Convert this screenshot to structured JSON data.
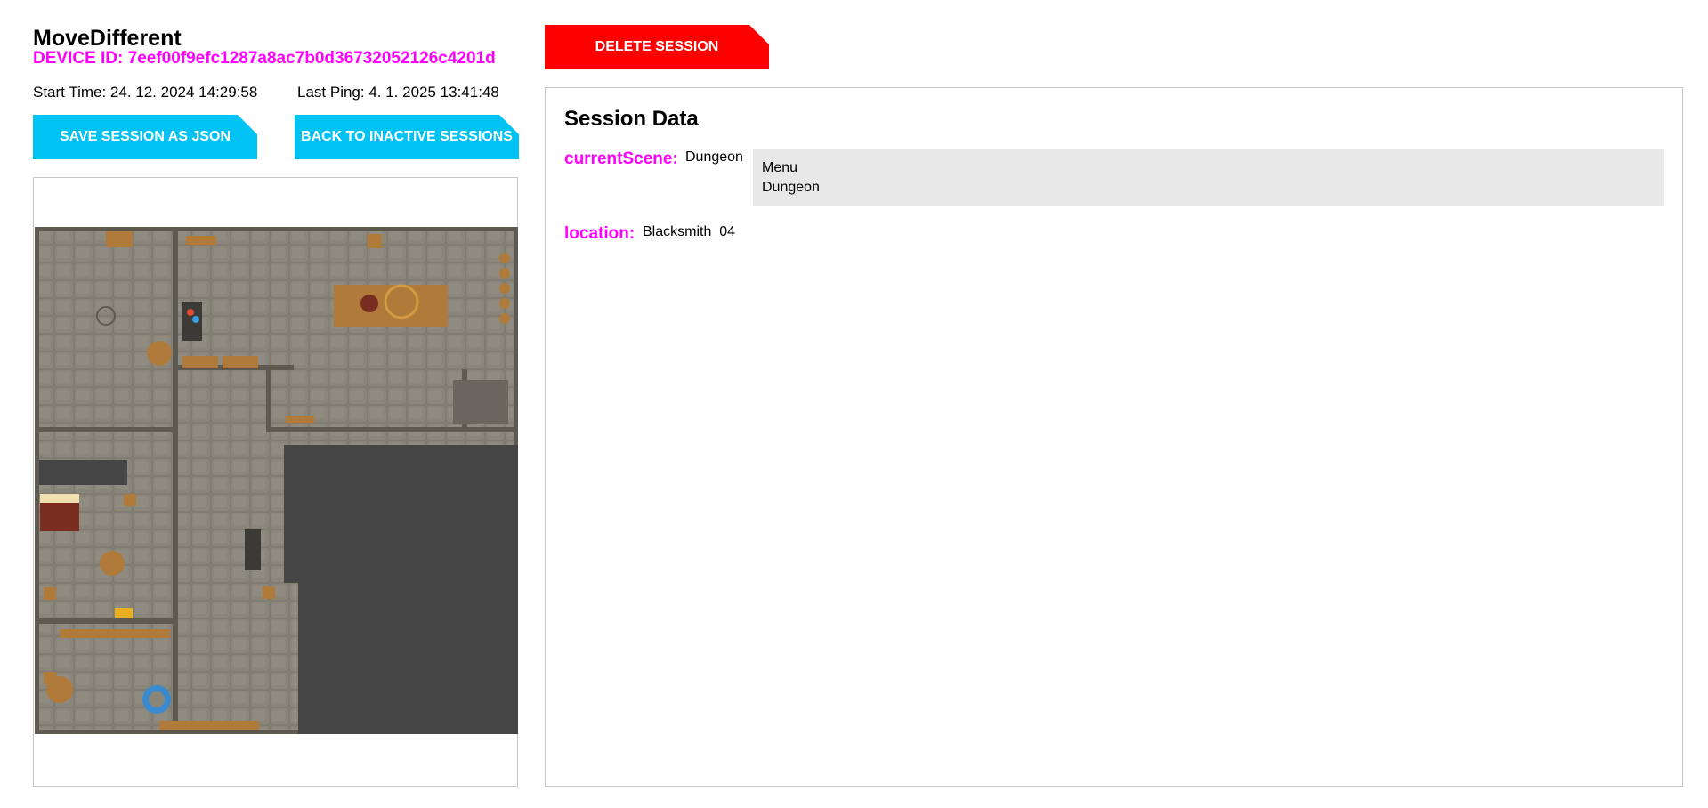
{
  "header": {
    "app_title": "MoveDifferent",
    "device_id": "DEVICE ID: 7eef00f9efc1287a8ac7b0d36732052126c4201d",
    "start_time": "Start Time: 24. 12. 2024 14:29:58",
    "last_ping": "Last Ping: 4. 1. 2025 13:41:48"
  },
  "buttons": {
    "save_json": "SAVE SESSION AS JSON",
    "back_inactive": "BACK TO INACTIVE SESSIONS",
    "delete_session": "DELETE SESSION"
  },
  "colors": {
    "accent_cyan": "#00c3f4",
    "danger_red": "#ff0000",
    "key_magenta": "#ff00ff"
  },
  "map": {
    "icon": "dungeon-map-image"
  },
  "session": {
    "title": "Session Data",
    "current_scene": {
      "key": "currentScene:",
      "value": "Dungeon",
      "options": [
        "Menu",
        "Dungeon"
      ]
    },
    "location": {
      "key": "location:",
      "value": "Blacksmith_04"
    }
  }
}
